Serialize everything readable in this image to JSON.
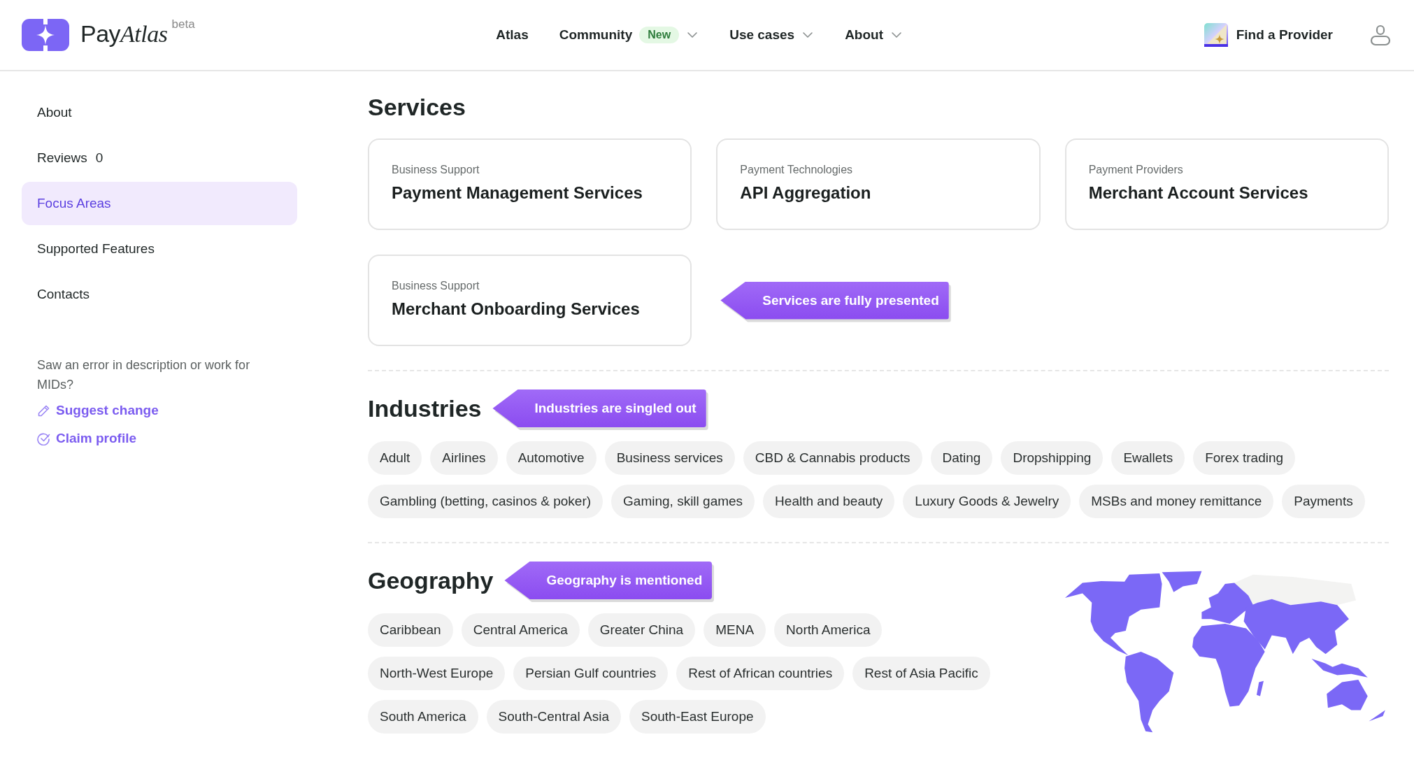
{
  "header": {
    "logo": {
      "name": "Pay",
      "name_italic": "Atlas",
      "badge": "beta"
    },
    "nav": [
      {
        "label": "Atlas",
        "kind": "link"
      },
      {
        "label": "Community",
        "badge": "New",
        "kind": "dropdown"
      },
      {
        "label": "Use cases",
        "kind": "dropdown"
      },
      {
        "label": "About",
        "kind": "dropdown"
      }
    ],
    "cta": "Find a Provider"
  },
  "sidebar": {
    "items": [
      {
        "label": "About",
        "selected": false
      },
      {
        "label": "Reviews",
        "count": "0",
        "selected": false
      },
      {
        "label": "Focus Areas",
        "selected": true
      },
      {
        "label": "Supported Features",
        "selected": false
      },
      {
        "label": "Contacts",
        "selected": false
      }
    ],
    "note": "Saw an error in description or work for MIDs?",
    "links": [
      {
        "label": "Suggest change",
        "kind": "edit"
      },
      {
        "label": "Claim profile",
        "kind": "claim"
      }
    ]
  },
  "services": {
    "title": "Services",
    "callout": "Services are fully presented",
    "cards": [
      {
        "category": "Business Support",
        "name": "Payment Management Services"
      },
      {
        "category": "Payment Technologies",
        "name": "API Aggregation"
      },
      {
        "category": "Payment Providers",
        "name": "Merchant Account Services"
      },
      {
        "category": "Business Support",
        "name": "Merchant Onboarding Services"
      }
    ]
  },
  "industries": {
    "title": "Industries",
    "callout": "Industries are singled out",
    "tags": [
      "Adult",
      "Airlines",
      "Automotive",
      "Business services",
      "CBD & Cannabis products",
      "Dating",
      "Dropshipping",
      "Ewallets",
      "Forex trading",
      "Gambling (betting, casinos & poker)",
      "Gaming, skill games",
      "Health and beauty",
      "Luxury Goods & Jewelry",
      "MSBs and money remittance",
      "Payments"
    ]
  },
  "geography": {
    "title": "Geography",
    "callout": "Geography is mentioned",
    "tags": [
      "Caribbean",
      "Central America",
      "Greater China",
      "MENA",
      "North America",
      "North-West Europe",
      "Persian Gulf countries",
      "Rest of African countries",
      "Rest of Asia Pacific",
      "South America",
      "South-Central Asia",
      "South-East Europe"
    ]
  }
}
